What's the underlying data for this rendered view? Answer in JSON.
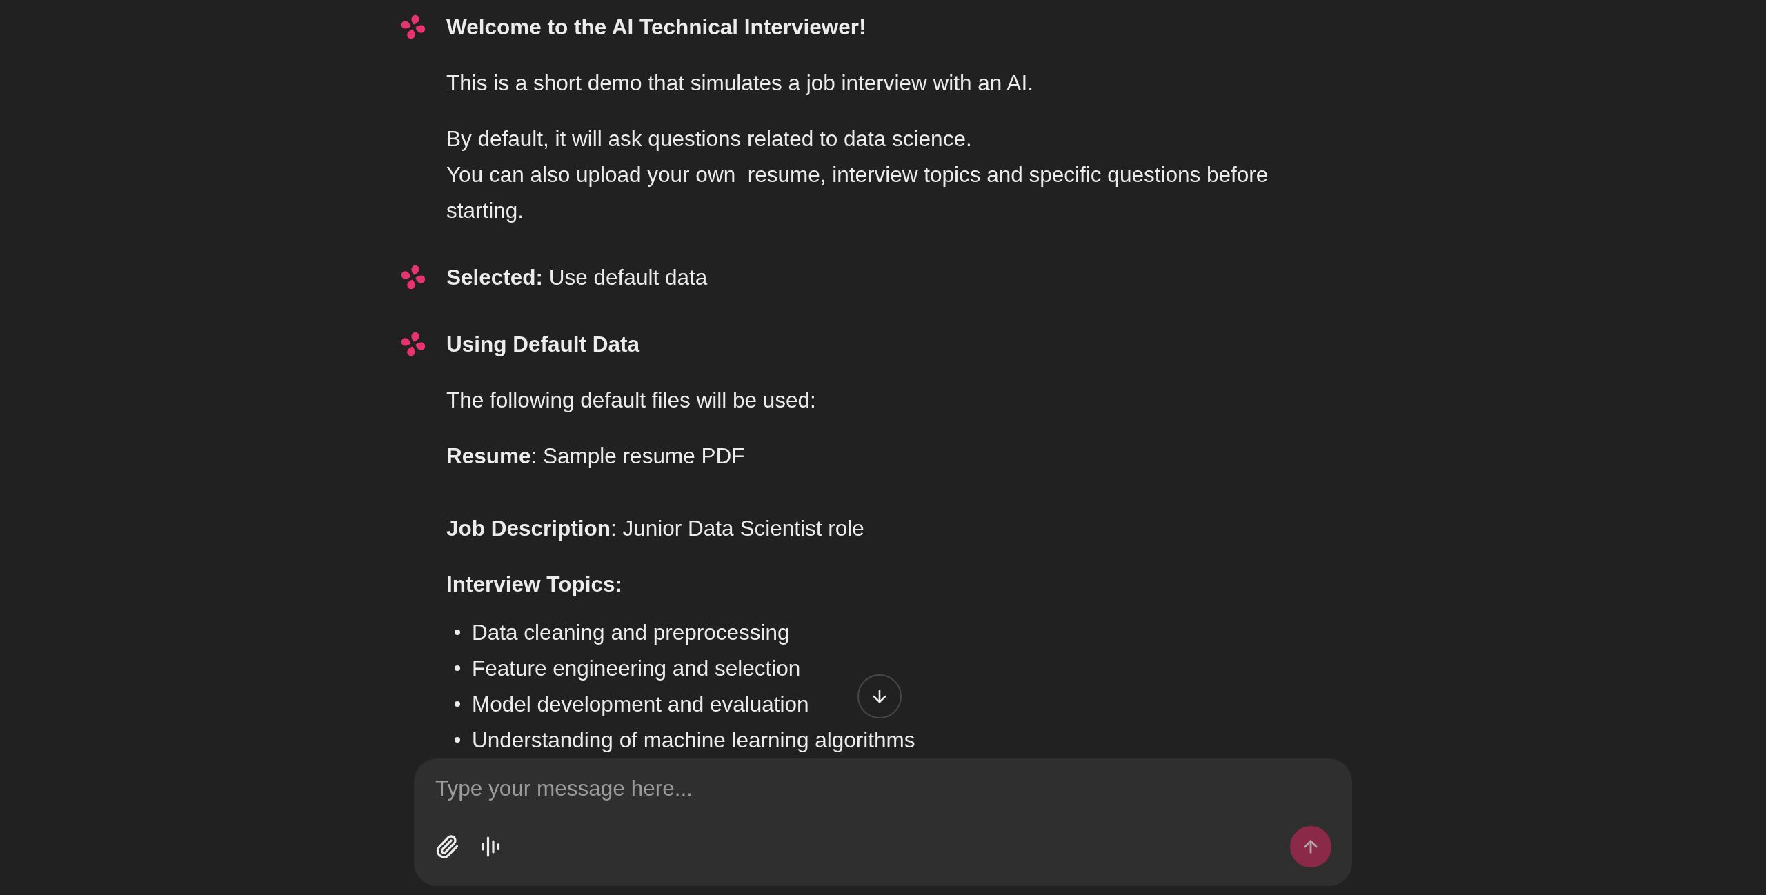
{
  "messages": [
    {
      "title": "Welcome to the AI Technical Interviewer!",
      "blocks": [
        {
          "kind": "paragraph",
          "lines": [
            "This is a short demo that simulates a job interview with an AI."
          ]
        },
        {
          "kind": "paragraph",
          "lines": [
            "By default, it will ask questions related to data science.",
            "You can also upload your own  resume, interview topics and specific questions before starting."
          ]
        }
      ]
    },
    {
      "text": "**Selected:** Use default data"
    },
    {
      "title": "Using Default Data",
      "blocks": [
        {
          "kind": "paragraph",
          "lines": [
            "The following default files will be used:"
          ]
        },
        {
          "kind": "paragraph",
          "lines": [
            "**Resume**: Sample resume PDF"
          ]
        },
        {
          "kind": "blank"
        },
        {
          "kind": "paragraph",
          "lines": [
            "**Job Description**: Junior Data Scientist role"
          ]
        },
        {
          "kind": "label",
          "text": "Interview Topics:"
        },
        {
          "kind": "list",
          "items": [
            "Data cleaning and preprocessing",
            "Feature engineering and selection",
            "Model development and evaluation",
            "Understanding of machine learning algorithms"
          ]
        }
      ]
    }
  ],
  "composer": {
    "placeholder": "Type your message here...",
    "send": {
      "disabled": true
    }
  }
}
